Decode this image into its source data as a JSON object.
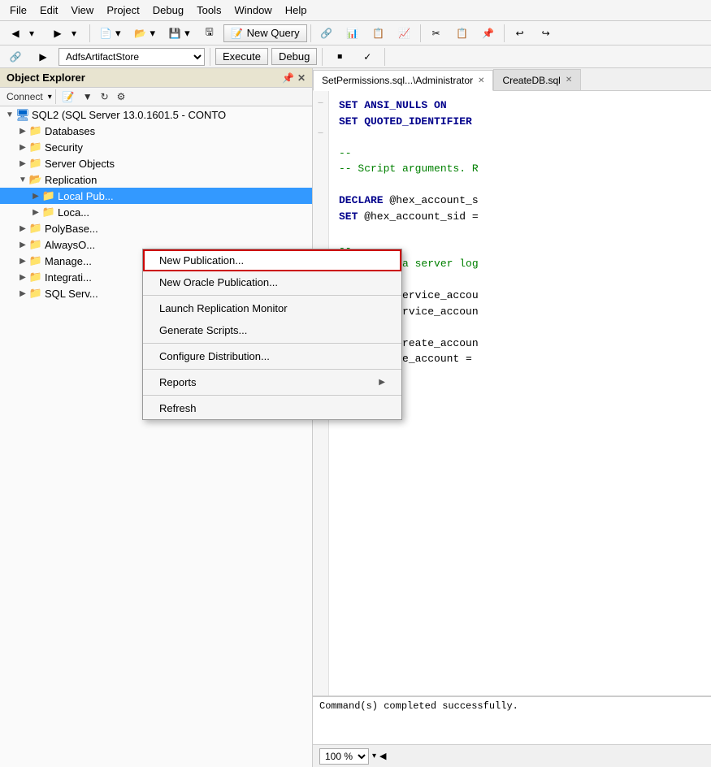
{
  "menubar": {
    "items": [
      "File",
      "Edit",
      "View",
      "Project",
      "Debug",
      "Tools",
      "Window",
      "Help"
    ]
  },
  "toolbar": {
    "new_query_label": "New Query",
    "execute_label": "Execute",
    "debug_label": "Debug",
    "db_value": "AdfsArtifactStore"
  },
  "object_explorer": {
    "title": "Object Explorer",
    "connect_label": "Connect",
    "server_node": "SQL2 (SQL Server 13.0.1601.5 - CONTO",
    "tree_items": [
      {
        "id": "databases",
        "label": "Databases",
        "indent": 1,
        "expanded": false,
        "type": "folder"
      },
      {
        "id": "security",
        "label": "Security",
        "indent": 1,
        "expanded": false,
        "type": "folder"
      },
      {
        "id": "server-objects",
        "label": "Server Objects",
        "indent": 1,
        "expanded": false,
        "type": "folder"
      },
      {
        "id": "replication",
        "label": "Replication",
        "indent": 1,
        "expanded": true,
        "type": "folder"
      },
      {
        "id": "local-pub",
        "label": "Local Pub...",
        "indent": 2,
        "expanded": false,
        "type": "folder",
        "selected": true
      },
      {
        "id": "local2",
        "label": "Loca...",
        "indent": 2,
        "expanded": false,
        "type": "folder"
      },
      {
        "id": "polybase",
        "label": "PolyBase...",
        "indent": 1,
        "expanded": false,
        "type": "folder"
      },
      {
        "id": "alwayson",
        "label": "AlwaysO...",
        "indent": 1,
        "expanded": false,
        "type": "folder"
      },
      {
        "id": "management",
        "label": "Manage...",
        "indent": 1,
        "expanded": false,
        "type": "folder"
      },
      {
        "id": "integration",
        "label": "Integrati...",
        "indent": 1,
        "expanded": false,
        "type": "folder"
      },
      {
        "id": "sql-server",
        "label": "SQL Serv...",
        "indent": 1,
        "expanded": false,
        "type": "folder"
      }
    ]
  },
  "context_menu": {
    "items": [
      {
        "id": "new-publication",
        "label": "New Publication...",
        "highlighted": true
      },
      {
        "id": "new-oracle-publication",
        "label": "New Oracle Publication..."
      },
      {
        "separator": true
      },
      {
        "id": "launch-replication-monitor",
        "label": "Launch Replication Monitor"
      },
      {
        "id": "generate-scripts",
        "label": "Generate Scripts..."
      },
      {
        "separator2": true
      },
      {
        "id": "configure-distribution",
        "label": "Configure Distribution..."
      },
      {
        "separator3": true
      },
      {
        "id": "reports",
        "label": "Reports",
        "has_arrow": true
      },
      {
        "separator4": true
      },
      {
        "id": "refresh",
        "label": "Refresh"
      }
    ]
  },
  "tabs": [
    {
      "id": "setpermissions",
      "label": "SetPermissions.sql...\\Administrator",
      "active": true
    },
    {
      "id": "createdb",
      "label": "CreateDB.sql",
      "active": false
    }
  ],
  "sql_code": [
    {
      "type": "keyword",
      "text": "SET ANSI_NULLS ON"
    },
    {
      "type": "keyword",
      "text": "SET QUOTED_IDENTIFIER"
    },
    {
      "type": "blank",
      "text": ""
    },
    {
      "type": "comment",
      "text": "--"
    },
    {
      "type": "comment",
      "text": "-- Script arguments. R"
    },
    {
      "type": "blank",
      "text": ""
    },
    {
      "type": "keyword",
      "text": "DECLARE @hex_account_s"
    },
    {
      "type": "keyword",
      "text": "SET @hex_account_sid ="
    },
    {
      "type": "blank",
      "text": ""
    },
    {
      "type": "comment",
      "text": "--"
    },
    {
      "type": "comment",
      "text": "-- Create a server log"
    },
    {
      "type": "blank",
      "text": ""
    },
    {
      "type": "keyword",
      "text": "DECLARE @service_accou"
    },
    {
      "type": "keyword",
      "text": "SELECT @service_accoun"
    },
    {
      "type": "blank",
      "text": ""
    },
    {
      "type": "keyword",
      "text": "DECLARE @create_accoun"
    },
    {
      "type": "keyword",
      "text": "SET @create_account ="
    }
  ],
  "results": {
    "text": "Command(s) completed successfully.",
    "zoom_value": "100 %"
  }
}
